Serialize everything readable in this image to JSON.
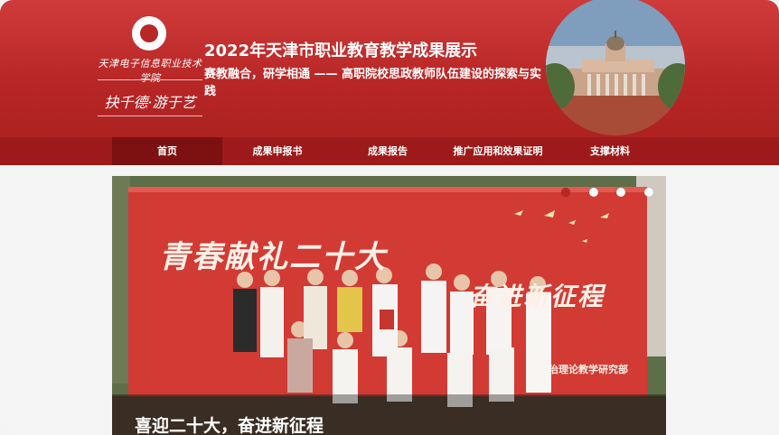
{
  "header": {
    "school_name": "天津电子信息职业技术学院",
    "motto": "抉千德·游于艺",
    "title": "2022年天津市职业教育教学成果展示",
    "subtitle": "赛教融合，研学相通 —— 高职院校思政教师队伍建设的探索与实践"
  },
  "nav": {
    "items": [
      {
        "label": "首页"
      },
      {
        "label": "成果申报书"
      },
      {
        "label": "成果报告"
      },
      {
        "label": "推广应用和效果证明"
      },
      {
        "label": "支撑材料"
      }
    ]
  },
  "banner": {
    "slide_text_main": "青春献礼二十大",
    "slide_text_right": "奋进新征程",
    "slide_text_small": "治理论教学研究部",
    "caption": "喜迎二十大，奋进新征程",
    "slide_count": 4,
    "active_slide": 1
  },
  "colors": {
    "brand_red": "#b82626",
    "nav_bg": "#9e1a1a",
    "nav_active": "#7d1111"
  }
}
